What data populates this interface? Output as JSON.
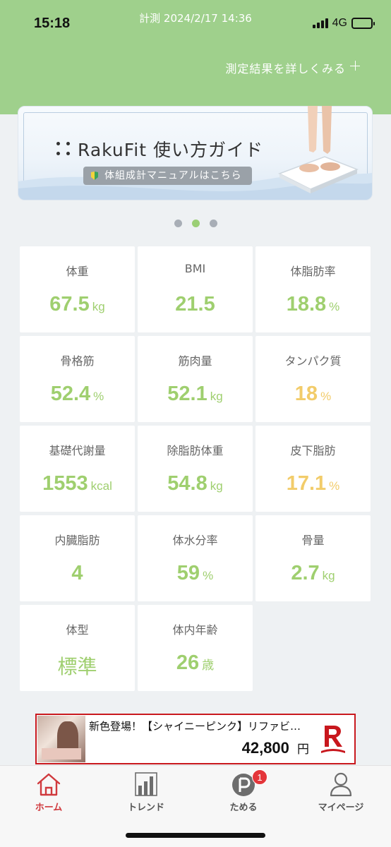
{
  "status_bar": {
    "time": "15:18",
    "network": "4G"
  },
  "header": {
    "measure_date": "計測 2024/2/17 14:36",
    "details_link": "測定結果を詳しくみる"
  },
  "banner": {
    "brand": "RakuFit",
    "title": "RakuFit 使い方ガイド",
    "manual_button": "体組成計マニュアルはこちら",
    "pager": {
      "count": 3,
      "active_index": 1
    }
  },
  "colors": {
    "green": "#9fcf6f",
    "yellow": "#f2cc6a",
    "accent_red": "#d0393d",
    "header_green": "#9fd08c"
  },
  "metrics": [
    {
      "label": "体重",
      "value": "67.5",
      "unit": "kg",
      "color": "#9fcf6f"
    },
    {
      "label": "BMI",
      "value": "21.5",
      "unit": "",
      "color": "#9fcf6f"
    },
    {
      "label": "体脂肪率",
      "value": "18.8",
      "unit": "%",
      "color": "#9fcf6f"
    },
    {
      "label": "骨格筋",
      "value": "52.4",
      "unit": "%",
      "color": "#9fcf6f"
    },
    {
      "label": "筋肉量",
      "value": "52.1",
      "unit": "kg",
      "color": "#9fcf6f"
    },
    {
      "label": "タンパク質",
      "value": "18",
      "unit": "%",
      "color": "#f2cc6a"
    },
    {
      "label": "基礎代謝量",
      "value": "1553",
      "unit": "kcal",
      "color": "#9fcf6f"
    },
    {
      "label": "除脂肪体重",
      "value": "54.8",
      "unit": "kg",
      "color": "#9fcf6f"
    },
    {
      "label": "皮下脂肪",
      "value": "17.1",
      "unit": "%",
      "color": "#f2cc6a"
    },
    {
      "label": "内臓脂肪",
      "value": "4",
      "unit": "",
      "color": "#9fcf6f"
    },
    {
      "label": "体水分率",
      "value": "59",
      "unit": "%",
      "color": "#9fcf6f"
    },
    {
      "label": "骨量",
      "value": "2.7",
      "unit": "kg",
      "color": "#9fcf6f"
    },
    {
      "label": "体型",
      "value": "標準",
      "unit": "",
      "color": "#9fcf6f"
    },
    {
      "label": "体内年齢",
      "value": "26",
      "unit": "歳",
      "color": "#9fcf6f"
    }
  ],
  "ad": {
    "title": "新色登場！【シャイニーピンク】リファビ…",
    "price": "42,800",
    "currency": "円"
  },
  "tabs": [
    {
      "label": "ホーム",
      "icon": "home-icon",
      "active": true
    },
    {
      "label": "トレンド",
      "icon": "bar-chart-icon",
      "active": false
    },
    {
      "label": "ためる",
      "icon": "points-icon",
      "active": false,
      "badge": "1"
    },
    {
      "label": "マイページ",
      "icon": "user-icon",
      "active": false
    }
  ]
}
